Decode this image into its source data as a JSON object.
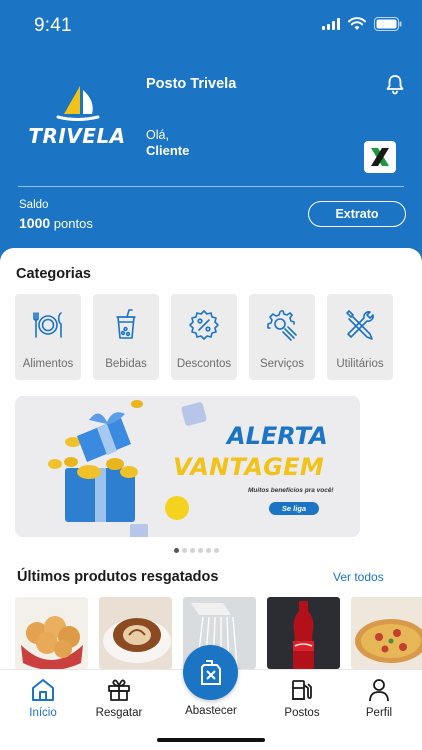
{
  "status": {
    "time": "9:41"
  },
  "brand": {
    "logo_text": "TRIVELA"
  },
  "header": {
    "station_name": "Posto Trivela",
    "greeting": "Olá,",
    "user_name": "Cliente",
    "balance_label": "Saldo",
    "balance_value": "1000",
    "balance_unit": "pontos",
    "statement_button": "Extrato",
    "notification_icon": "bell-icon",
    "partner_icon": "x-logo-icon"
  },
  "categories": {
    "title": "Categorias",
    "items": [
      {
        "label": "Alimentos",
        "icon": "plate-cutlery-icon"
      },
      {
        "label": "Bebidas",
        "icon": "drink-cup-icon"
      },
      {
        "label": "Descontos",
        "icon": "discount-badge-icon"
      },
      {
        "label": "Serviços",
        "icon": "gear-wrench-icon"
      },
      {
        "label": "Utilitários",
        "icon": "tools-icon"
      }
    ]
  },
  "banner": {
    "title_line1": "ALERTA",
    "title_line2": "VANTAGEM",
    "subtitle": "Muitos benefícios pra você!",
    "cta": "Se liga",
    "slide_count": 6,
    "active_slide": 1
  },
  "recent": {
    "title": "Últimos produtos resgatados",
    "see_all": "Ver todos",
    "products": [
      {
        "name": "pao-de-queijo-image"
      },
      {
        "name": "cappuccino-image"
      },
      {
        "name": "shower-image"
      },
      {
        "name": "coca-cola-image"
      },
      {
        "name": "pizza-image"
      }
    ]
  },
  "tabbar": {
    "items": [
      {
        "label": "Início",
        "icon": "home-icon",
        "active": true
      },
      {
        "label": "Resgatar",
        "icon": "gift-icon",
        "active": false
      },
      {
        "label": "Abastecer",
        "icon": "fuel-can-icon",
        "active": false
      },
      {
        "label": "Postos",
        "icon": "fuel-pump-icon",
        "active": false
      },
      {
        "label": "Perfil",
        "icon": "user-icon",
        "active": false
      }
    ]
  },
  "colors": {
    "brand_blue": "#1c74c4",
    "banner_yellow": "#f2c218",
    "card_gray": "#ececec"
  }
}
